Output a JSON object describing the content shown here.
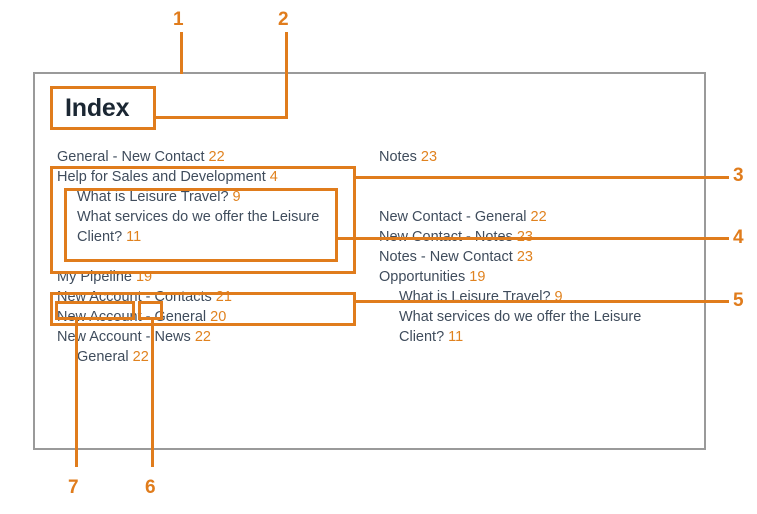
{
  "colors": {
    "accent": "#e07c1c",
    "page_number": "#e0821f",
    "entry_text": "#3f4c5c",
    "title_text": "#1b2733",
    "page_border": "#9a9a9a",
    "background": "#ffffff"
  },
  "document": {
    "title": "Index"
  },
  "index": {
    "left_column": [
      {
        "label": "General - New Contact",
        "page": "22",
        "indent": false
      },
      {
        "label": "Help for Sales and Development",
        "page": "4",
        "indent": false
      },
      {
        "label": "What is Leisure Travel?",
        "page": "9",
        "indent": true
      },
      {
        "label": "What services do we offer the Leisure",
        "page": "",
        "indent": true
      },
      {
        "label": "Client?",
        "page": "11",
        "indent": true
      },
      {
        "label": "",
        "page": "",
        "indent": false
      },
      {
        "label": "My Pipeline",
        "page": "19",
        "indent": false
      },
      {
        "label": "New Account - Contacts",
        "page": "21",
        "indent": false
      },
      {
        "label": "New Account - General",
        "page": "20",
        "indent": false
      },
      {
        "label": "New Account - News",
        "page": "22",
        "indent": false
      },
      {
        "label": "General",
        "page": "22",
        "indent": true
      }
    ],
    "right_column": [
      {
        "label": "Notes",
        "page": "23",
        "indent": false
      },
      {
        "label": "",
        "page": "",
        "indent": false
      },
      {
        "label": "",
        "page": "",
        "indent": false
      },
      {
        "label": "New Contact - General",
        "page": "22",
        "indent": false
      },
      {
        "label": "New Contact - Notes",
        "page": "23",
        "indent": false
      },
      {
        "label": "Notes - New Contact",
        "page": "23",
        "indent": false
      },
      {
        "label": "Opportunities",
        "page": "19",
        "indent": false
      },
      {
        "label": "What is Leisure Travel?",
        "page": "9",
        "indent": true
      },
      {
        "label": "What services do we offer the Leisure",
        "page": "",
        "indent": true
      },
      {
        "label": "Client?",
        "page": "11",
        "indent": true
      }
    ]
  },
  "callouts": [
    {
      "id": "1",
      "number": "1"
    },
    {
      "id": "2",
      "number": "2"
    },
    {
      "id": "3",
      "number": "3"
    },
    {
      "id": "4",
      "number": "4"
    },
    {
      "id": "5",
      "number": "5"
    },
    {
      "id": "6",
      "number": "6"
    },
    {
      "id": "7",
      "number": "7"
    }
  ]
}
